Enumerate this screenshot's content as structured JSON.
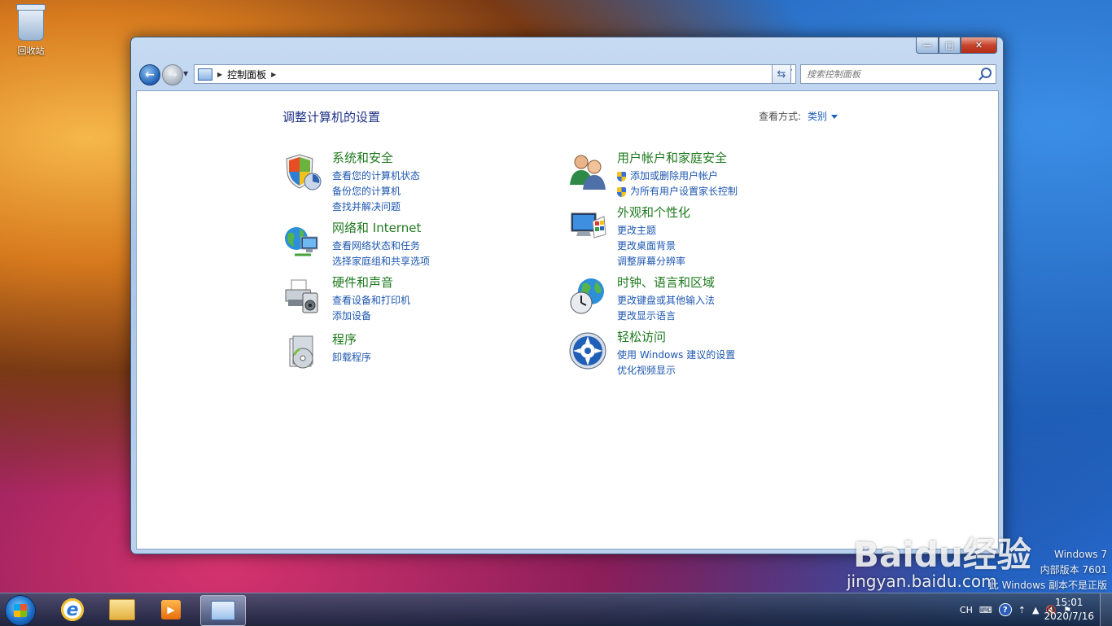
{
  "desktop": {
    "recycle_bin_label": "回收站"
  },
  "window": {
    "address": {
      "crumb": "控制面板"
    },
    "search": {
      "placeholder": "搜索控制面板"
    },
    "page_title": "调整计算机的设置",
    "view_by": {
      "label": "查看方式:",
      "value": "类别"
    },
    "categories_left": [
      {
        "title": "系统和安全",
        "icon": "shield-icon",
        "links": [
          "查看您的计算机状态",
          "备份您的计算机",
          "查找并解决问题"
        ]
      },
      {
        "title": "网络和 Internet",
        "icon": "network-icon",
        "links": [
          "查看网络状态和任务",
          "选择家庭组和共享选项"
        ]
      },
      {
        "title": "硬件和声音",
        "icon": "printer-icon",
        "links": [
          "查看设备和打印机",
          "添加设备"
        ]
      },
      {
        "title": "程序",
        "icon": "programs-icon",
        "links": [
          "卸载程序"
        ]
      }
    ],
    "categories_right": [
      {
        "title": "用户帐户和家庭安全",
        "icon": "users-icon",
        "links": [
          "添加或删除用户帐户",
          "为所有用户设置家长控制"
        ]
      },
      {
        "title": "外观和个性化",
        "icon": "display-icon",
        "links": [
          "更改主题",
          "更改桌面背景",
          "调整屏幕分辨率"
        ]
      },
      {
        "title": "时钟、语言和区域",
        "icon": "globe-clock-icon",
        "links": [
          "更改键盘或其他输入法",
          "更改显示语言"
        ]
      },
      {
        "title": "轻松访问",
        "icon": "ease-of-access-icon",
        "links": [
          "使用 Windows 建议的设置",
          "优化视频显示"
        ]
      }
    ]
  },
  "watermark": {
    "line1": "Windows 7",
    "line2": "内部版本 7601",
    "line3": "此 Windows 副本不是正版",
    "baidu_logo": "Baidu经验",
    "baidu_url": "jingyan.baidu.com"
  },
  "taskbar": {
    "lang": "CH",
    "time": "15:01",
    "date": "2020/7/16"
  },
  "colors": {
    "link": "#1d57b0",
    "category_title": "#1f7a1f",
    "page_title": "#1e3287"
  }
}
